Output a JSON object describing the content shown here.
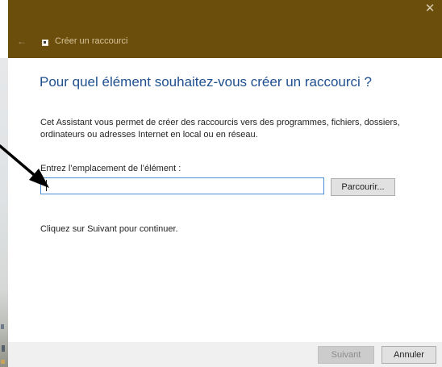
{
  "window": {
    "title": "Créer un raccourci",
    "close_glyph": "✕",
    "back_glyph": "←",
    "titlebar_color": "#6b4e0c"
  },
  "content": {
    "heading": "Pour quel élément souhaitez-vous créer un raccourci ?",
    "description": "Cet Assistant vous permet de créer des raccourcis vers des programmes, fichiers, dossiers, ordinateurs ou adresses Internet en local ou en réseau.",
    "location_label": "Entrez l’emplacement de l’élément :",
    "location_value": "",
    "browse_label": "Parcourir...",
    "continue_text": "Cliquez sur Suivant pour continuer."
  },
  "footer": {
    "next_label": "Suivant",
    "cancel_label": "Annuler"
  },
  "colors": {
    "heading": "#1f4f8f",
    "input_border": "#4a8fd6",
    "footer_bg": "#f0f0f0"
  },
  "icons": [
    "close-icon",
    "back-arrow-icon",
    "shortcut-app-icon",
    "annotation-arrow-icon"
  ]
}
